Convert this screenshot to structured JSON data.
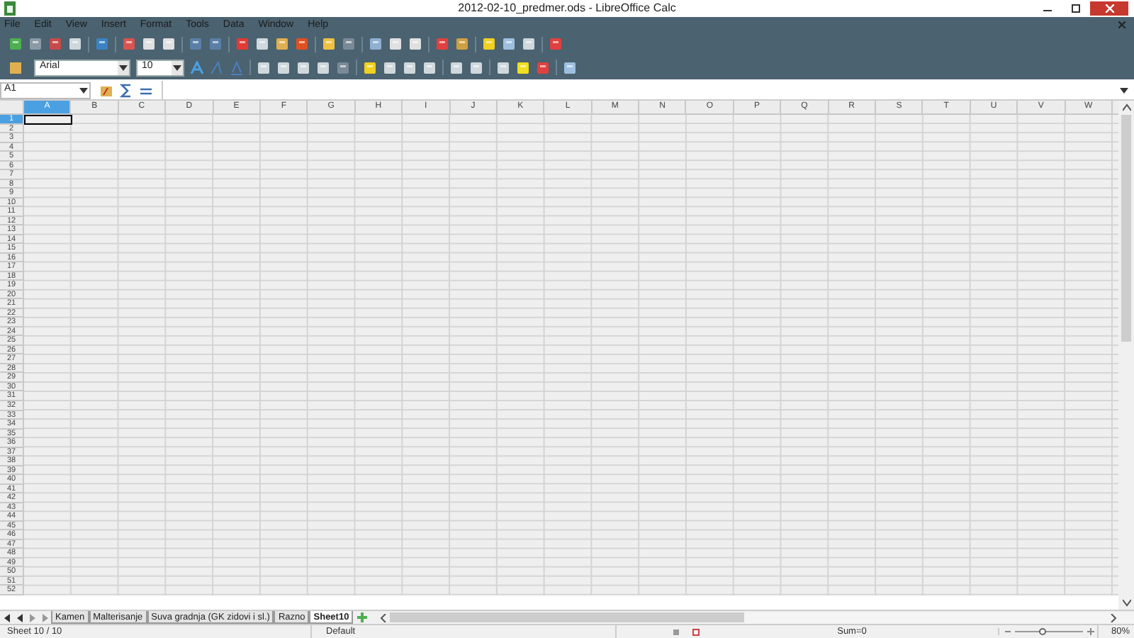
{
  "window": {
    "title": "2012-02-10_predmer.ods - LibreOffice Calc"
  },
  "menu": [
    "File",
    "Edit",
    "View",
    "Insert",
    "Format",
    "Tools",
    "Data",
    "Window",
    "Help"
  ],
  "formatting": {
    "font": "Arial",
    "size": "10"
  },
  "formula_bar": {
    "name_box": "A1"
  },
  "columns": [
    {
      "label": "A",
      "selected": true
    },
    {
      "label": "B",
      "selected": false
    },
    {
      "label": "C",
      "selected": false
    },
    {
      "label": "D",
      "selected": false
    },
    {
      "label": "E",
      "selected": false
    },
    {
      "label": "F",
      "selected": false
    },
    {
      "label": "G",
      "selected": false
    },
    {
      "label": "H",
      "selected": false
    },
    {
      "label": "I",
      "selected": false
    },
    {
      "label": "J",
      "selected": false
    },
    {
      "label": "K",
      "selected": false
    },
    {
      "label": "L",
      "selected": false
    },
    {
      "label": "M",
      "selected": false
    },
    {
      "label": "N",
      "selected": false
    },
    {
      "label": "O",
      "selected": false
    },
    {
      "label": "P",
      "selected": false
    },
    {
      "label": "Q",
      "selected": false
    },
    {
      "label": "R",
      "selected": false
    },
    {
      "label": "S",
      "selected": false
    },
    {
      "label": "T",
      "selected": false
    },
    {
      "label": "U",
      "selected": false
    },
    {
      "label": "V",
      "selected": false
    },
    {
      "label": "W",
      "selected": false
    }
  ],
  "rows": [
    {
      "label": "1",
      "selected": true
    },
    {
      "label": "2",
      "selected": false
    },
    {
      "label": "3",
      "selected": false
    },
    {
      "label": "4",
      "selected": false
    },
    {
      "label": "5",
      "selected": false
    },
    {
      "label": "6",
      "selected": false
    },
    {
      "label": "7",
      "selected": false
    },
    {
      "label": "8",
      "selected": false
    },
    {
      "label": "9",
      "selected": false
    },
    {
      "label": "10",
      "selected": false
    },
    {
      "label": "11",
      "selected": false
    },
    {
      "label": "12",
      "selected": false
    },
    {
      "label": "13",
      "selected": false
    },
    {
      "label": "14",
      "selected": false
    },
    {
      "label": "15",
      "selected": false
    },
    {
      "label": "16",
      "selected": false
    },
    {
      "label": "17",
      "selected": false
    },
    {
      "label": "18",
      "selected": false
    },
    {
      "label": "19",
      "selected": false
    },
    {
      "label": "20",
      "selected": false
    },
    {
      "label": "21",
      "selected": false
    },
    {
      "label": "22",
      "selected": false
    },
    {
      "label": "23",
      "selected": false
    },
    {
      "label": "24",
      "selected": false
    },
    {
      "label": "25",
      "selected": false
    },
    {
      "label": "26",
      "selected": false
    },
    {
      "label": "27",
      "selected": false
    },
    {
      "label": "28",
      "selected": false
    },
    {
      "label": "29",
      "selected": false
    },
    {
      "label": "30",
      "selected": false
    },
    {
      "label": "31",
      "selected": false
    },
    {
      "label": "32",
      "selected": false
    },
    {
      "label": "33",
      "selected": false
    },
    {
      "label": "34",
      "selected": false
    },
    {
      "label": "35",
      "selected": false
    },
    {
      "label": "36",
      "selected": false
    },
    {
      "label": "37",
      "selected": false
    },
    {
      "label": "38",
      "selected": false
    },
    {
      "label": "39",
      "selected": false
    },
    {
      "label": "40",
      "selected": false
    },
    {
      "label": "41",
      "selected": false
    },
    {
      "label": "42",
      "selected": false
    },
    {
      "label": "43",
      "selected": false
    },
    {
      "label": "44",
      "selected": false
    },
    {
      "label": "45",
      "selected": false
    },
    {
      "label": "46",
      "selected": false
    },
    {
      "label": "47",
      "selected": false
    },
    {
      "label": "48",
      "selected": false
    },
    {
      "label": "49",
      "selected": false
    },
    {
      "label": "50",
      "selected": false
    },
    {
      "label": "51",
      "selected": false
    },
    {
      "label": "52",
      "selected": false
    }
  ],
  "sheet_tabs": [
    {
      "label": "Kamen",
      "selected": false
    },
    {
      "label": "Malterisanje",
      "selected": false
    },
    {
      "label": "Suva gradnja (GK zidovi i sl.)",
      "selected": false
    },
    {
      "label": "Razno",
      "selected": false
    },
    {
      "label": "Sheet10",
      "selected": true
    }
  ],
  "status_bar": {
    "sheet": "Sheet 10 / 10",
    "style": "Default",
    "sum": "Sum=0",
    "zoom": {
      "level": 0.4,
      "reading": "80%"
    }
  }
}
